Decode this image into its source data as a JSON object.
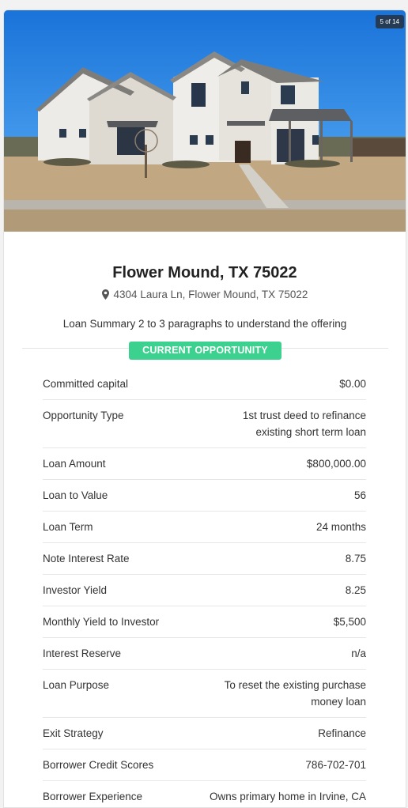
{
  "photo": {
    "counter": "5 of 14"
  },
  "listing": {
    "title": "Flower Mound, TX 75022",
    "address": "4304 Laura Ln, Flower Mound, TX 75022",
    "summary": "Loan Summary  2 to 3 paragraphs to understand the offering",
    "badge": "CURRENT OPPORTUNITY"
  },
  "details": [
    {
      "label": "Committed capital",
      "value": "$0.00"
    },
    {
      "label": "Opportunity Type",
      "value": "1st trust deed to refinance existing short term loan"
    },
    {
      "label": "Loan Amount",
      "value": "$800,000.00"
    },
    {
      "label": "Loan to Value",
      "value": "56"
    },
    {
      "label": "Loan Term",
      "value": "24 months"
    },
    {
      "label": "Note Interest Rate",
      "value": "8.75"
    },
    {
      "label": "Investor Yield",
      "value": "8.25"
    },
    {
      "label": "Monthly Yield to Investor",
      "value": "$5,500"
    },
    {
      "label": "Interest Reserve",
      "value": "n/a"
    },
    {
      "label": "Loan Purpose",
      "value": "To reset the existing purchase money loan"
    },
    {
      "label": "Exit Strategy",
      "value": "Refinance"
    },
    {
      "label": "Borrower Credit Scores",
      "value": "786-702-701"
    },
    {
      "label": "Borrower Experience",
      "value": "Owns primary home in Irvine, CA"
    }
  ],
  "colors": {
    "badge": "#3dd18f",
    "sky": "#1f7fe0"
  }
}
